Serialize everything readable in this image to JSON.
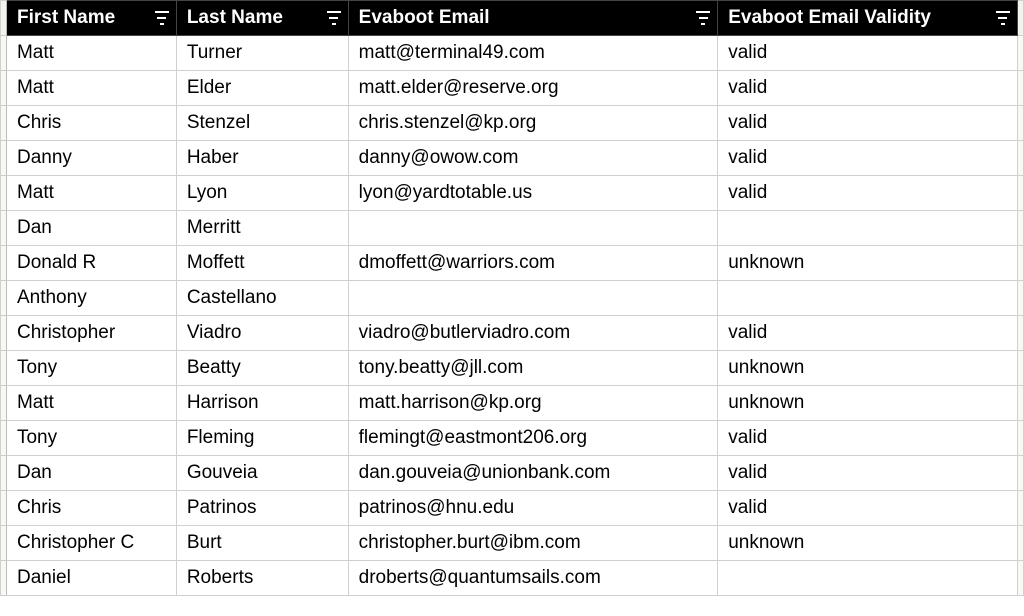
{
  "columns": [
    {
      "key": "first_name",
      "label": "First Name"
    },
    {
      "key": "last_name",
      "label": "Last Name"
    },
    {
      "key": "email",
      "label": "Evaboot Email"
    },
    {
      "key": "validity",
      "label": "Evaboot Email Validity"
    }
  ],
  "rows": [
    {
      "first_name": "Matt",
      "last_name": "Turner",
      "email": "matt@terminal49.com",
      "validity": "valid"
    },
    {
      "first_name": "Matt",
      "last_name": "Elder",
      "email": "matt.elder@reserve.org",
      "validity": "valid"
    },
    {
      "first_name": "Chris",
      "last_name": "Stenzel",
      "email": "chris.stenzel@kp.org",
      "validity": "valid"
    },
    {
      "first_name": "Danny",
      "last_name": "Haber",
      "email": "danny@owow.com",
      "validity": "valid"
    },
    {
      "first_name": "Matt",
      "last_name": "Lyon",
      "email": "lyon@yardtotable.us",
      "validity": "valid"
    },
    {
      "first_name": "Dan",
      "last_name": "Merritt",
      "email": "",
      "validity": ""
    },
    {
      "first_name": "Donald R",
      "last_name": "Moffett",
      "email": "dmoffett@warriors.com",
      "validity": "unknown"
    },
    {
      "first_name": "Anthony",
      "last_name": "Castellano",
      "email": "",
      "validity": ""
    },
    {
      "first_name": "Christopher",
      "last_name": "Viadro",
      "email": "viadro@butlerviadro.com",
      "validity": "valid"
    },
    {
      "first_name": "Tony",
      "last_name": "Beatty",
      "email": "tony.beatty@jll.com",
      "validity": "unknown"
    },
    {
      "first_name": "Matt",
      "last_name": "Harrison",
      "email": "matt.harrison@kp.org",
      "validity": "unknown"
    },
    {
      "first_name": "Tony",
      "last_name": "Fleming",
      "email": "flemingt@eastmont206.org",
      "validity": "valid"
    },
    {
      "first_name": "Dan",
      "last_name": "Gouveia",
      "email": "dan.gouveia@unionbank.com",
      "validity": "valid"
    },
    {
      "first_name": "Chris",
      "last_name": "Patrinos",
      "email": "patrinos@hnu.edu",
      "validity": "valid"
    },
    {
      "first_name": "Christopher C",
      "last_name": "Burt",
      "email": "christopher.burt@ibm.com",
      "validity": "unknown"
    },
    {
      "first_name": "Daniel",
      "last_name": "Roberts",
      "email": "droberts@quantumsails.com",
      "validity": ""
    }
  ]
}
